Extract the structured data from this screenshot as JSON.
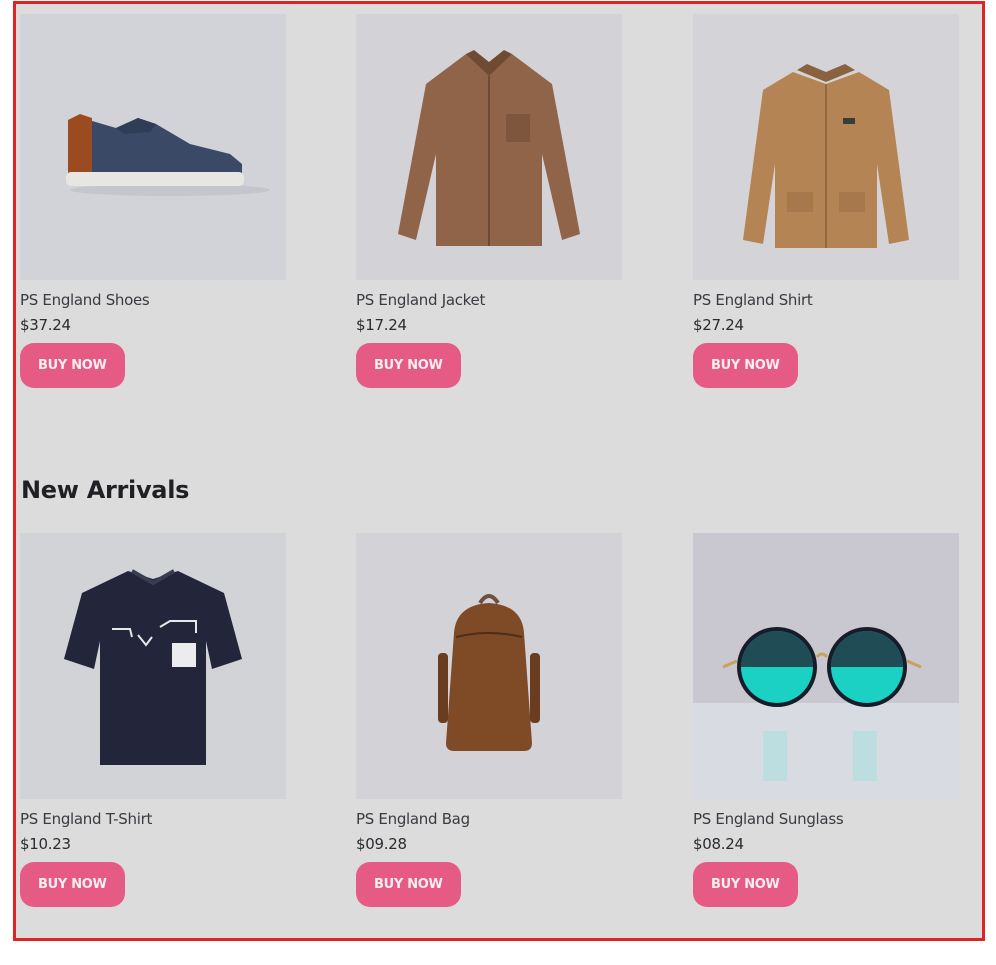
{
  "featured": {
    "products": [
      {
        "name": "PS England Shoes",
        "price": "$37.24",
        "button": "BUY NOW",
        "image": "sneaker-image"
      },
      {
        "name": "PS England Jacket",
        "price": "$17.24",
        "button": "BUY NOW",
        "image": "jacket-image"
      },
      {
        "name": "PS England Shirt",
        "price": "$27.24",
        "button": "BUY NOW",
        "image": "shirt-image"
      }
    ]
  },
  "new_arrivals": {
    "title": "New Arrivals",
    "products": [
      {
        "name": "PS England T-Shirt",
        "price": "$10.23",
        "button": "BUY NOW",
        "image": "tshirt-image"
      },
      {
        "name": "PS England Bag",
        "price": "$09.28",
        "button": "BUY NOW",
        "image": "backpack-image"
      },
      {
        "name": "PS England Sunglass",
        "price": "$08.24",
        "button": "BUY NOW",
        "image": "sunglasses-image"
      }
    ]
  },
  "colors": {
    "border": "#e02424",
    "background": "#dcdcdd",
    "button": "#e65b86"
  }
}
